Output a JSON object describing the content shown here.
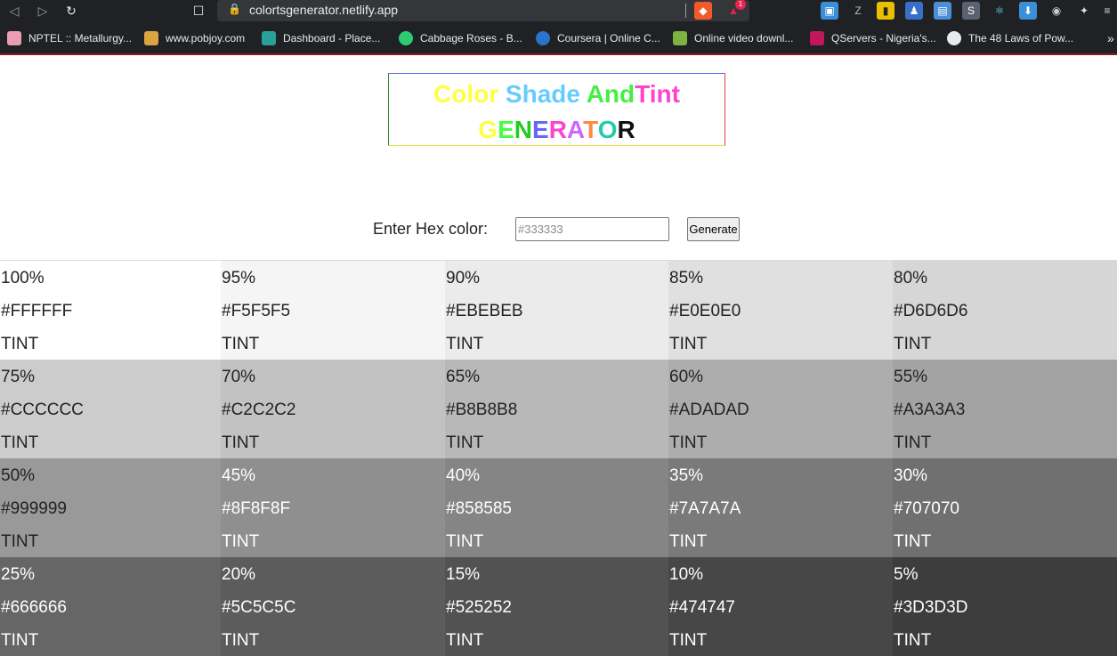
{
  "browser": {
    "url": "colortsgenerator.netlify.app",
    "bookmarks": [
      {
        "label": "NPTEL :: Metallurgy...",
        "color": "#e8a0b0"
      },
      {
        "label": "www.pobjoy.com",
        "color": "#d9a441"
      },
      {
        "label": "Dashboard - Place...",
        "color": "#2aa198"
      },
      {
        "label": "Cabbage Roses - B...",
        "color": "#2ecc71"
      },
      {
        "label": "Coursera | Online C...",
        "color": "#2a73cc"
      },
      {
        "label": "Online video downl...",
        "color": "#7cb342"
      },
      {
        "label": "QServers - Nigeria's...",
        "color": "#c2185b"
      },
      {
        "label": "The 48 Laws of Pow...",
        "color": "#e8eaed"
      }
    ],
    "more_bookmarks": "»",
    "extension_badge": "1"
  },
  "page": {
    "title_line1": [
      {
        "text": "Color ",
        "color": "#ffff44"
      },
      {
        "text": "Shade ",
        "color": "#66ccff"
      },
      {
        "text": "And",
        "color": "#44ee44"
      },
      {
        "text": "Tint",
        "color": "#ff44cc"
      }
    ],
    "title_line2": [
      {
        "text": "G",
        "color": "#ffff44"
      },
      {
        "text": "E",
        "color": "#44ff44"
      },
      {
        "text": "N",
        "color": "#22cc22"
      },
      {
        "text": "E",
        "color": "#6666ff"
      },
      {
        "text": "R",
        "color": "#ff44cc"
      },
      {
        "text": "A",
        "color": "#cc66ff"
      },
      {
        "text": "T",
        "color": "#ff8844"
      },
      {
        "text": "O",
        "color": "#22ccaa"
      },
      {
        "text": "R",
        "color": "#111111"
      }
    ],
    "hex_label": "Enter Hex color:",
    "hex_placeholder": "#333333",
    "generate_label": "Generate"
  },
  "swatches": [
    {
      "percent": "100%",
      "hex": "#FFFFFF",
      "type": "TINT"
    },
    {
      "percent": "95%",
      "hex": "#F5F5F5",
      "type": "TINT"
    },
    {
      "percent": "90%",
      "hex": "#EBEBEB",
      "type": "TINT"
    },
    {
      "percent": "85%",
      "hex": "#E0E0E0",
      "type": "TINT"
    },
    {
      "percent": "80%",
      "hex": "#D6D6D6",
      "type": "TINT"
    },
    {
      "percent": "75%",
      "hex": "#CCCCCC",
      "type": "TINT"
    },
    {
      "percent": "70%",
      "hex": "#C2C2C2",
      "type": "TINT"
    },
    {
      "percent": "65%",
      "hex": "#B8B8B8",
      "type": "TINT"
    },
    {
      "percent": "60%",
      "hex": "#ADADAD",
      "type": "TINT"
    },
    {
      "percent": "55%",
      "hex": "#A3A3A3",
      "type": "TINT"
    },
    {
      "percent": "50%",
      "hex": "#999999",
      "type": "TINT"
    },
    {
      "percent": "45%",
      "hex": "#8F8F8F",
      "type": "TINT"
    },
    {
      "percent": "40%",
      "hex": "#858585",
      "type": "TINT"
    },
    {
      "percent": "35%",
      "hex": "#7A7A7A",
      "type": "TINT"
    },
    {
      "percent": "30%",
      "hex": "#707070",
      "type": "TINT"
    },
    {
      "percent": "25%",
      "hex": "#666666",
      "type": "TINT"
    },
    {
      "percent": "20%",
      "hex": "#5C5C5C",
      "type": "TINT"
    },
    {
      "percent": "15%",
      "hex": "#525252",
      "type": "TINT"
    },
    {
      "percent": "10%",
      "hex": "#474747",
      "type": "TINT"
    },
    {
      "percent": "5%",
      "hex": "#3D3D3D",
      "type": "TINT"
    }
  ]
}
